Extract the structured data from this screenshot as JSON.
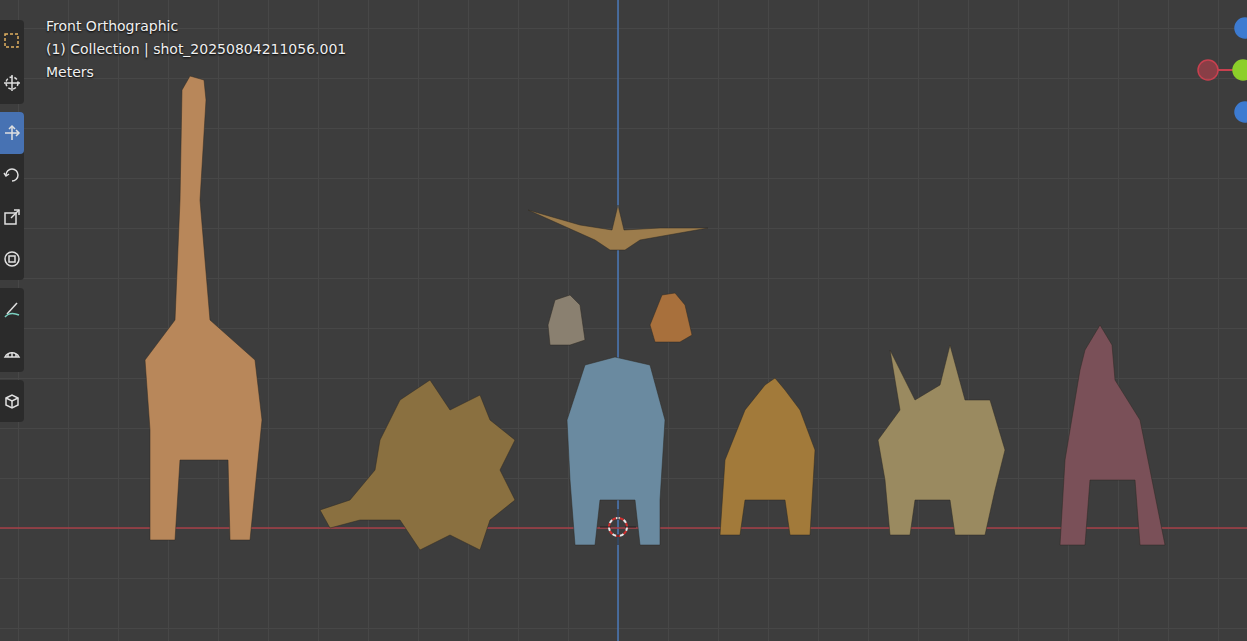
{
  "viewport": {
    "view": "Front Orthographic",
    "collection": "(1) Collection | shot_20250804211056.001",
    "units": "Meters"
  },
  "toolbar": [
    [
      {
        "kind": "select",
        "selected": false
      },
      {
        "kind": "cursor",
        "selected": false
      }
    ],
    [
      {
        "kind": "move",
        "selected": true
      },
      {
        "kind": "rotate",
        "selected": false
      },
      {
        "kind": "scale",
        "selected": false
      },
      {
        "kind": "transform",
        "selected": false
      }
    ],
    [
      {
        "kind": "annotate",
        "selected": false
      },
      {
        "kind": "measure",
        "selected": false
      }
    ],
    [
      {
        "kind": "add-cube",
        "selected": false
      }
    ]
  ],
  "gizmo": [
    {
      "color": "#3d7bd1"
    },
    {
      "color": "#c8404f"
    },
    {
      "color": "#8ccf2a"
    },
    {
      "color": "#3d7bd1"
    }
  ],
  "models": [
    {
      "color": "#b8875a"
    },
    {
      "color": "#8a7040"
    },
    {
      "color": "#9c7c4c"
    },
    {
      "color": "#8a8070"
    },
    {
      "color": "#a8703c"
    },
    {
      "color": "#6a8aa0"
    },
    {
      "color": "#a27a3a"
    },
    {
      "color": "#9a8a60"
    },
    {
      "color": "#7a5058"
    }
  ]
}
